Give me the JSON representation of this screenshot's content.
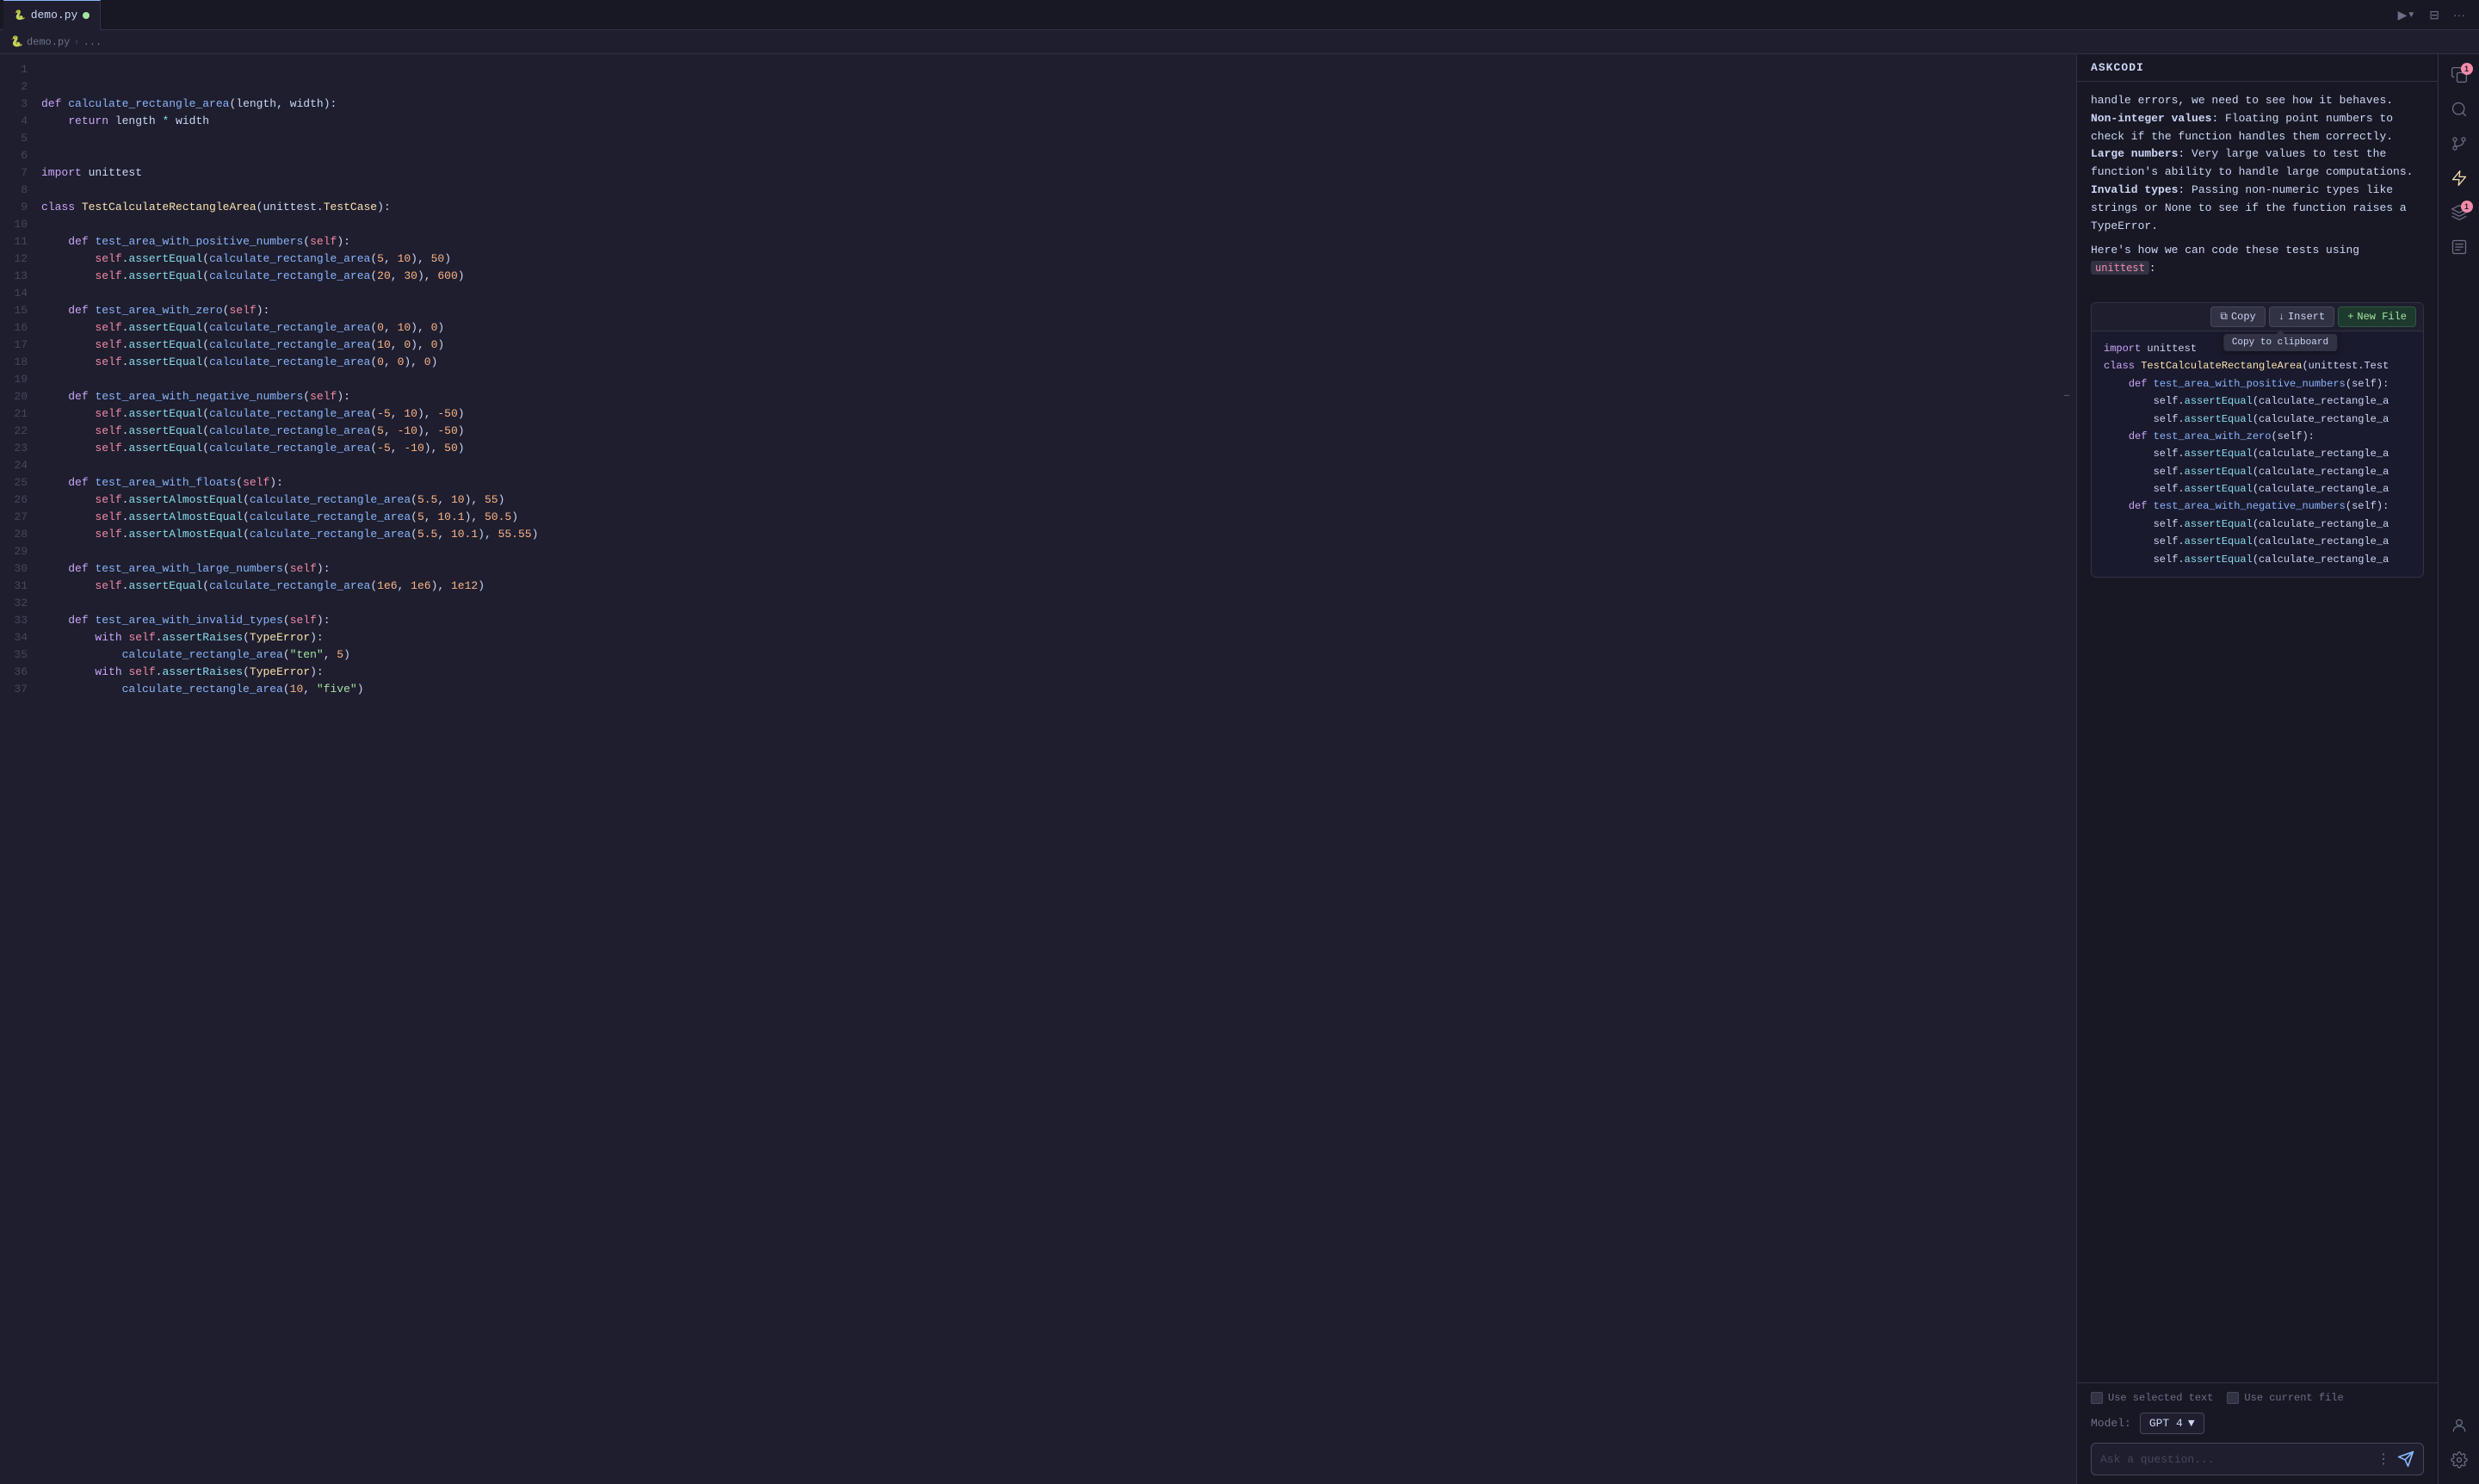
{
  "tab": {
    "label": "demo.py",
    "modified": true,
    "icon": "python-icon"
  },
  "breadcrumb": {
    "items": [
      "demo.py",
      "..."
    ]
  },
  "toolbar": {
    "run_label": "▶",
    "split_label": "⊟",
    "more_label": "···"
  },
  "panel": {
    "title": "ASKCODI"
  },
  "chat": {
    "text1": "handle errors, we need to see how it behaves.",
    "bold1": "Non-integer values",
    "text2": ": Floating point numbers to check if the function handles them correctly.",
    "bold2": "Large numbers",
    "text3": ": Very large values to test the function's ability to handle large computations.",
    "bold3": "Invalid types",
    "text4": ": Passing non-numeric types like strings or None to see if the function raises a TypeError.",
    "text5": "Here's how we can code these tests using ",
    "inline_code": "unittest",
    "text6": ":"
  },
  "code_toolbar": {
    "copy_label": "Copy",
    "insert_label": "Insert",
    "new_file_label": "New File",
    "tooltip_label": "Copy to clipboard"
  },
  "code_preview": [
    {
      "line": "import unittest",
      "indent": 0
    },
    {
      "line": "",
      "indent": 0
    },
    {
      "line": "class TestCalculateRectangleArea(unittest.Test",
      "indent": 0
    },
    {
      "line": "",
      "indent": 0
    },
    {
      "line": "    def test_area_with_positive_numbers(self):",
      "indent": 1
    },
    {
      "line": "        self.assertEqual(calculate_rectangle_a",
      "indent": 2
    },
    {
      "line": "        self.assertEqual(calculate_rectangle_a",
      "indent": 2
    },
    {
      "line": "",
      "indent": 0
    },
    {
      "line": "    def test_area_with_zero(self):",
      "indent": 1
    },
    {
      "line": "        self.assertEqual(calculate_rectangle_a",
      "indent": 2
    },
    {
      "line": "        self.assertEqual(calculate_rectangle_a",
      "indent": 2
    },
    {
      "line": "        self.assertEqual(calculate_rectangle_a",
      "indent": 2
    },
    {
      "line": "",
      "indent": 0
    },
    {
      "line": "    def test_area_with_negative_numbers(self):",
      "indent": 1
    },
    {
      "line": "        self.assertEqual(calculate_rectangle_a",
      "indent": 2
    },
    {
      "line": "        self.assertEqual(calculate_rectangle_a",
      "indent": 2
    },
    {
      "line": "        self.assertEqual(calculate_rectangle_a",
      "indent": 2
    }
  ],
  "footer": {
    "use_selected_text_label": "Use selected text",
    "use_current_file_label": "Use current file",
    "model_label": "Model:",
    "model_value": "GPT 4",
    "ask_placeholder": "Ask a question..."
  },
  "editor": {
    "lines": [
      {
        "n": 1,
        "content": ""
      },
      {
        "n": 2,
        "content": ""
      },
      {
        "n": 3,
        "content": "def calculate_rectangle_area(length, width):"
      },
      {
        "n": 4,
        "content": "    return length * width"
      },
      {
        "n": 5,
        "content": ""
      },
      {
        "n": 6,
        "content": ""
      },
      {
        "n": 7,
        "content": "import unittest"
      },
      {
        "n": 8,
        "content": ""
      },
      {
        "n": 9,
        "content": "class TestCalculateRectangleArea(unittest.TestCase):"
      },
      {
        "n": 10,
        "content": ""
      },
      {
        "n": 11,
        "content": "    def test_area_with_positive_numbers(self):"
      },
      {
        "n": 12,
        "content": "        self.assertEqual(calculate_rectangle_area(5, 10), 50)"
      },
      {
        "n": 13,
        "content": "        self.assertEqual(calculate_rectangle_area(20, 30), 600)"
      },
      {
        "n": 14,
        "content": ""
      },
      {
        "n": 15,
        "content": "    def test_area_with_zero(self):"
      },
      {
        "n": 16,
        "content": "        self.assertEqual(calculate_rectangle_area(0, 10), 0)"
      },
      {
        "n": 17,
        "content": "        self.assertEqual(calculate_rectangle_area(10, 0), 0)"
      },
      {
        "n": 18,
        "content": "        self.assertEqual(calculate_rectangle_area(0, 0), 0)"
      },
      {
        "n": 19,
        "content": ""
      },
      {
        "n": 20,
        "content": "    def test_area_with_negative_numbers(self):"
      },
      {
        "n": 21,
        "content": "        self.assertEqual(calculate_rectangle_area(-5, 10), -50)"
      },
      {
        "n": 22,
        "content": "        self.assertEqual(calculate_rectangle_area(5, -10), -50)"
      },
      {
        "n": 23,
        "content": "        self.assertEqual(calculate_rectangle_area(-5, -10), 50)"
      },
      {
        "n": 24,
        "content": ""
      },
      {
        "n": 25,
        "content": "    def test_area_with_floats(self):"
      },
      {
        "n": 26,
        "content": "        self.assertAlmostEqual(calculate_rectangle_area(5.5, 10), 55)"
      },
      {
        "n": 27,
        "content": "        self.assertAlmostEqual(calculate_rectangle_area(5, 10.1), 50.5)"
      },
      {
        "n": 28,
        "content": "        self.assertAlmostEqual(calculate_rectangle_area(5.5, 10.1), 55.55)"
      },
      {
        "n": 29,
        "content": ""
      },
      {
        "n": 30,
        "content": "    def test_area_with_large_numbers(self):"
      },
      {
        "n": 31,
        "content": "        self.assertEqual(calculate_rectangle_area(1e6, 1e6), 1e12)"
      },
      {
        "n": 32,
        "content": ""
      },
      {
        "n": 33,
        "content": "    def test_area_with_invalid_types(self):"
      },
      {
        "n": 34,
        "content": "        with self.assertRaises(TypeError):"
      },
      {
        "n": 35,
        "content": "            calculate_rectangle_area(\"ten\", 5)"
      },
      {
        "n": 36,
        "content": "        with self.assertRaises(TypeError):"
      },
      {
        "n": 37,
        "content": "            calculate_rectangle_area(10, \"five\")"
      }
    ]
  },
  "activity_bar": {
    "buttons": [
      {
        "id": "copy-icon",
        "label": "⧉",
        "badge": "1"
      },
      {
        "id": "search-icon",
        "label": "🔍",
        "badge": null
      },
      {
        "id": "branch-icon",
        "label": "⎇",
        "badge": null
      },
      {
        "id": "ai-icon",
        "label": "⚡",
        "badge": null
      },
      {
        "id": "layers-icon",
        "label": "▤",
        "badge": "1"
      },
      {
        "id": "notes-icon",
        "label": "📝",
        "badge": null
      },
      {
        "id": "user-icon",
        "label": "👤",
        "badge": null
      },
      {
        "id": "settings-icon",
        "label": "⚙",
        "badge": null
      }
    ]
  }
}
